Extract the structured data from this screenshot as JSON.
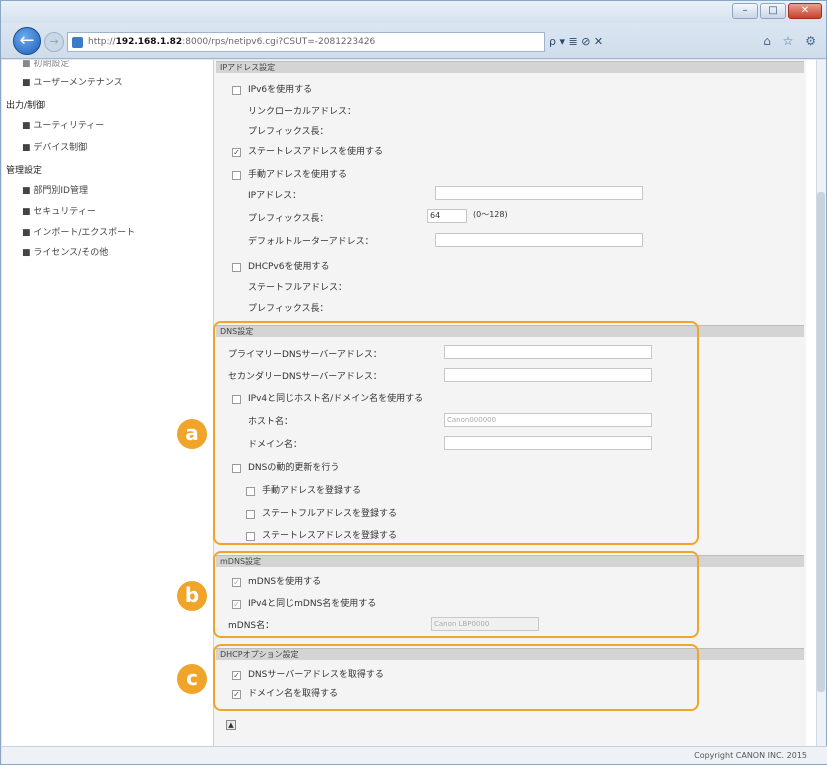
{
  "browser": {
    "url_prefix": "http://",
    "url_host": "192.168.1.82",
    "url_rest": ":8000/rps/netipv6.cgi?CSUT=-2081223426",
    "addr_tools": "ρ ▾ ≣ ⊘ ✕",
    "nav_icons": "⌂ ☆ ⚙",
    "copyright": "Copyright CANON INC. 2015"
  },
  "sidebar": {
    "top_partial": "■ 初期設定",
    "user_maint": "■ ユーザーメンテナンス",
    "heading_output": "出力/制御",
    "utility": "■ ユーティリティー",
    "device_control": "■ デバイス制御",
    "heading_admin": "管理設定",
    "dept_admin": "■ 部門別ID管理",
    "security": "■ セキュリティー",
    "import_export": "■ インポート/エクスポート",
    "license_other": "■ ライセンス/その他"
  },
  "ip": {
    "section": "IPアドレス設定",
    "use_ipv6": "IPv6を使用する",
    "link_local": "リンクローカルアドレス：",
    "prefix_len": "プレフィックス長：",
    "use_stateless": "ステートレスアドレスを使用する",
    "use_manual": "手動アドレスを使用する",
    "address": "IPアドレス：",
    "prefix_len2": "プレフィックス長：",
    "prefix_value": "64",
    "prefix_hint": "(0〜128)",
    "default_router": "デフォルトルーターアドレス：",
    "use_dhcpv6": "DHCPv6を使用する",
    "stateful": "ステートフルアドレス：",
    "prefix_len3": "プレフィックス長："
  },
  "dns": {
    "section": "DNS設定",
    "primary": "プライマリーDNSサーバーアドレス：",
    "secondary": "セカンダリーDNSサーバーアドレス：",
    "same_host": "IPv4と同じホスト名/ドメイン名を使用する",
    "host": "ホスト名：",
    "host_value": "Canon000000",
    "domain": "ドメイン名：",
    "dynamic_update": "DNSの動的更新を行う",
    "reg_manual": "手動アドレスを登録する",
    "reg_stateful": "ステートフルアドレスを登録する",
    "reg_stateless": "ステートレスアドレスを登録する"
  },
  "mdns": {
    "section": "mDNS設定",
    "use_mdns": "mDNSを使用する",
    "same_name": "IPv4と同じmDNS名を使用する",
    "name": "mDNS名：",
    "name_value": "Canon LBP0000"
  },
  "dhcp": {
    "section": "DHCPオプション設定",
    "get_dns": "DNSサーバーアドレスを取得する",
    "get_domain": "ドメイン名を取得する"
  },
  "callouts": {
    "a": "a",
    "b": "b",
    "c": "c"
  },
  "colors": {
    "callout": "#f0a52a",
    "browser_blue": "#1f5fb5"
  }
}
